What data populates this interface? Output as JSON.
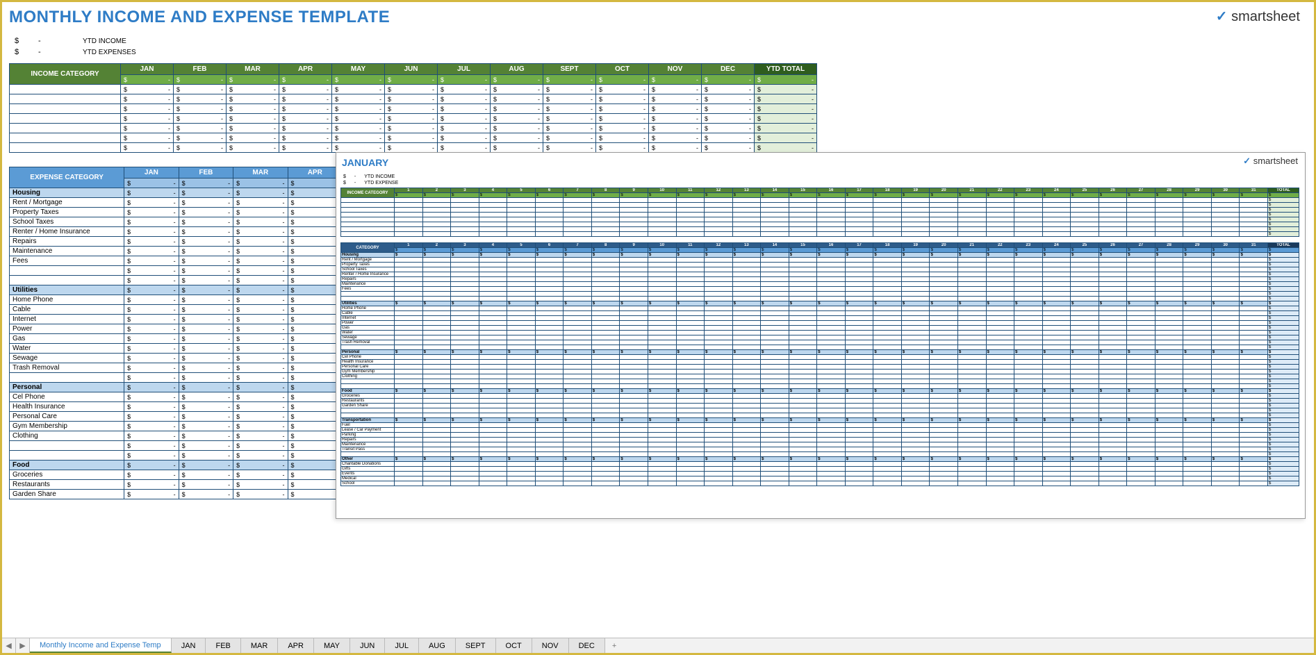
{
  "app": {
    "title": "MONTHLY INCOME AND EXPENSE TEMPLATE",
    "logo": "smartsheet"
  },
  "summary": {
    "rows": [
      {
        "dollar": "$",
        "amount": "-",
        "label": "YTD INCOME"
      },
      {
        "dollar": "$",
        "amount": "-",
        "label": "YTD EXPENSES"
      }
    ]
  },
  "income": {
    "cat_header": "INCOME CATEGORY",
    "months": [
      "JAN",
      "FEB",
      "MAR",
      "APR",
      "MAY",
      "JUN",
      "JUL",
      "AUG",
      "SEPT",
      "OCT",
      "NOV",
      "DEC"
    ],
    "ytd_header": "YTD TOTAL",
    "dollar": "$",
    "dash": "-",
    "row_count": 7
  },
  "expense": {
    "cat_header": "EXPENSE CATEGORY",
    "months": [
      "JAN",
      "FEB",
      "MAR",
      "APR"
    ],
    "dollar": "$",
    "dash": "-",
    "sections": [
      {
        "name": "Housing",
        "items": [
          "Rent / Mortgage",
          "Property Taxes",
          "School Taxes",
          "Renter / Home Insurance",
          "Repairs",
          "Maintenance",
          "Fees"
        ],
        "blanks": 2
      },
      {
        "name": "Utilities",
        "items": [
          "Home Phone",
          "Cable",
          "Internet",
          "Power",
          "Gas",
          "Water",
          "Sewage",
          "Trash Removal"
        ],
        "blanks": 1
      },
      {
        "name": "Personal",
        "items": [
          "Cel Phone",
          "Health Insurance",
          "Personal Care",
          "Gym Membership",
          "Clothing"
        ],
        "blanks": 2
      },
      {
        "name": "Food",
        "items": [
          "Groceries",
          "Restaurants",
          "Garden Share"
        ],
        "blanks": 0
      }
    ]
  },
  "overlay": {
    "title": "JANUARY",
    "logo": "smartsheet",
    "summary": [
      {
        "d": "$",
        "a": "-",
        "lbl": "YTD INCOME"
      },
      {
        "d": "$",
        "a": "-",
        "lbl": "YTD EXPENSE"
      }
    ],
    "days": [
      "1",
      "2",
      "3",
      "4",
      "5",
      "6",
      "7",
      "8",
      "9",
      "10",
      "11",
      "12",
      "13",
      "14",
      "15",
      "16",
      "17",
      "18",
      "19",
      "20",
      "21",
      "22",
      "23",
      "24",
      "25",
      "26",
      "27",
      "28",
      "29",
      "30",
      "31"
    ],
    "total": "TOTAL",
    "income": {
      "cat": "INCOME CATEGORY",
      "rows": 8
    },
    "expense": {
      "cat": "CATEGORY",
      "sections": [
        {
          "name": "Housing",
          "items": [
            "Rent / Mortgage",
            "Property Taxes",
            "School Taxes",
            "Renter / Home Insurance",
            "Repairs",
            "Maintenance",
            "Fees"
          ],
          "blanks": 2
        },
        {
          "name": "Utilities",
          "items": [
            "Home Phone",
            "Cable",
            "Internet",
            "Power",
            "Gas",
            "Water",
            "Sewage",
            "Trash Removal"
          ],
          "blanks": 1
        },
        {
          "name": "Personal",
          "items": [
            "Cel Phone",
            "Health Insurance",
            "Personal Care",
            "Gym Membership",
            "Clothing"
          ],
          "blanks": 2
        },
        {
          "name": "Food",
          "items": [
            "Groceries",
            "Restaurants",
            "Garden Share"
          ],
          "blanks": 2
        },
        {
          "name": "Transportation",
          "items": [
            "Fuel",
            "Lease / Car Payment",
            "Parking",
            "Repairs",
            "Maintenance",
            "Transit Pass"
          ],
          "blanks": 1
        },
        {
          "name": "Other",
          "items": [
            "Charitable Donations",
            "Gifts",
            "Events",
            "Medical",
            "School"
          ],
          "blanks": 0
        }
      ]
    }
  },
  "tabs": {
    "active": "Monthly Income and Expense Temp",
    "list": [
      "JAN",
      "FEB",
      "MAR",
      "APR",
      "MAY",
      "JUN",
      "JUL",
      "AUG",
      "SEPT",
      "OCT",
      "NOV",
      "DEC"
    ],
    "plus": "+"
  }
}
